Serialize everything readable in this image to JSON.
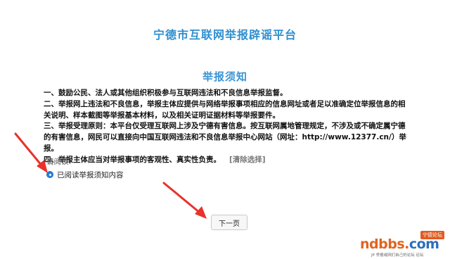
{
  "site": {
    "title": "宁德市互联网举报辟谣平台"
  },
  "notice": {
    "title": "举报须知",
    "paragraphs": [
      "一、鼓励公民、法人或其他组织积极参与互联网违法和不良信息举报监督。",
      "二、举报网上违法和不良信息，举报主体应提供与网络举报事项相应的信息网址或者足以准确定位举报信息的相关说明、样本截图等举报基本材料，以及相关证明证据材料等举报要件。",
      "三、举报受理原则：本平台仅受理互联网上涉及宁德有害信息。按互联网属地管理规定，不涉及或不确定属宁德的有害信息，网民可以直接向中国互联网违法和不良信息举报中心网站（网址：http://www.12377.cn/）举报。",
      "四、举报主体应当对举报事项的客观性、真实性负责。"
    ],
    "clear_label": "[清除选择]"
  },
  "agreement": {
    "prompt": "请阅读!",
    "option_label": "已阅读举报须知内容",
    "checked": true
  },
  "actions": {
    "next_label": "下一页"
  },
  "watermark": {
    "brand_orange": "ndbbs.",
    "brand_blue": "com",
    "tag": "宁德论坛",
    "sub": "JP 举报或网们自己的论坛 论坛"
  },
  "colors": {
    "accent": "#2f8fd0",
    "arrow": "#e8322a",
    "radio": "#2b7fd6"
  }
}
